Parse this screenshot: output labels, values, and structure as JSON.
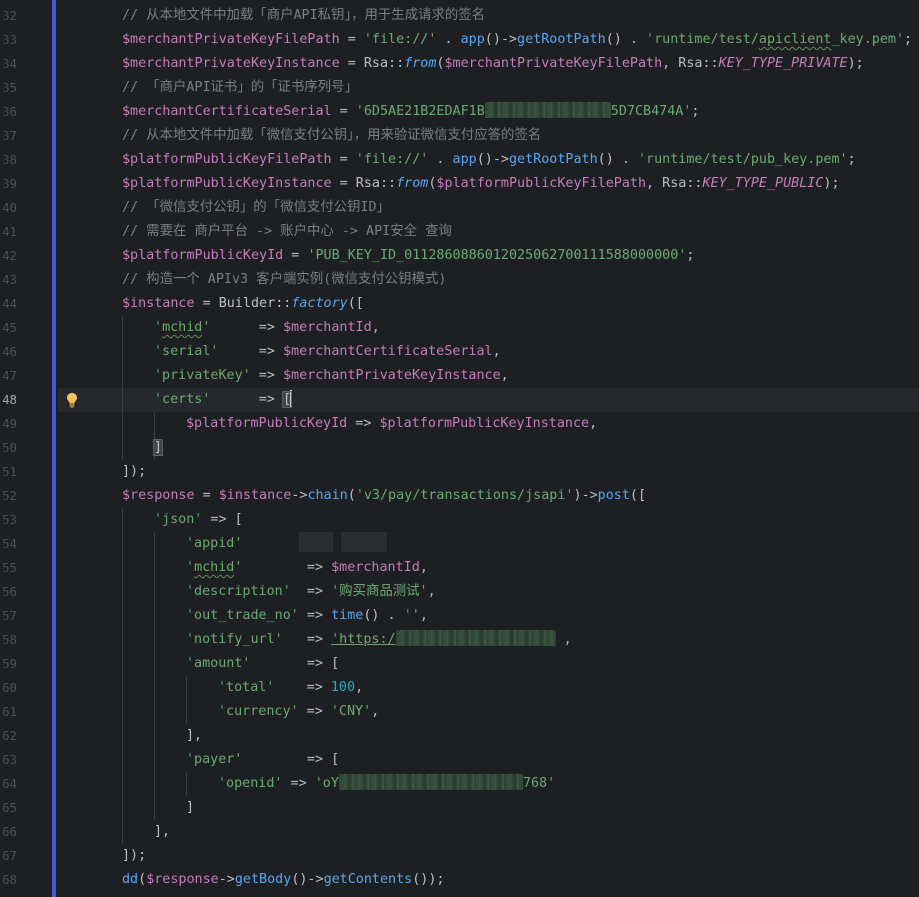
{
  "editor": {
    "line_numbers": [
      "32",
      "33",
      "34",
      "35",
      "36",
      "37",
      "38",
      "39",
      "40",
      "41",
      "42",
      "43",
      "44",
      "45",
      "46",
      "47",
      "48",
      "49",
      "50",
      "51",
      "52",
      "53",
      "54",
      "55",
      "56",
      "57",
      "58",
      "59",
      "60",
      "61",
      "62",
      "63",
      "64",
      "65",
      "66",
      "67",
      "68"
    ],
    "active_line": "48",
    "comments": {
      "l32": "// 从本地文件中加载「商户API私钥」，用于生成请求的签名",
      "l35": "// 「商户API证书」的「证书序列号」",
      "l37": "// 从本地文件中加载「微信支付公钥」，用来验证微信支付应答的签名",
      "l40": "// 「微信支付公钥」的「微信支付公钥ID」",
      "l41": "// 需要在 商户平台 -> 账户中心 -> API安全 查询",
      "l43": "// 构造一个 APIv3 客户端实例(微信支付公钥模式)"
    },
    "vars": {
      "merchantPrivateKeyFilePath": "$merchantPrivateKeyFilePath",
      "merchantPrivateKeyInstance": "$merchantPrivateKeyInstance",
      "merchantCertificateSerial": "$merchantCertificateSerial",
      "platformPublicKeyFilePath": "$platformPublicKeyFilePath",
      "platformPublicKeyInstance": "$platformPublicKeyInstance",
      "platformPublicKeyId": "$platformPublicKeyId",
      "instance": "$instance",
      "response": "$response",
      "merchantId": "$merchantId"
    },
    "strings": {
      "file_proto": "'file://'",
      "apiclient_path_a": "'runtime/test/",
      "apiclient_path_b": "apiclient",
      "apiclient_path_c": "_key.pem'",
      "serial_a": "'6D5AE21B2EDAF1B",
      "serial_b": "5D7CB474A'",
      "pub_key_path": "'runtime/test/pub_key.pem'",
      "pub_key_id": "'PUB_KEY_ID_0112860886012025062700111588000000'",
      "mchid": "'mchid'",
      "serial": "'serial'",
      "privateKey": "'privateKey'",
      "certs": "'certs'",
      "chain_path": "'v3/pay/transactions/jsapi'",
      "json": "'json'",
      "appid": "'appid'",
      "description": "'description'",
      "description_val": "'购买商品测试'",
      "out_trade_no": "'out_trade_no'",
      "empty": "''",
      "notify_url": "'notify_url'",
      "notify_val_a": "'https:/",
      "amount": "'amount'",
      "total": "'total'",
      "currency": "'currency'",
      "cny": "'CNY'",
      "payer": "'payer'",
      "openid": "'openid'",
      "openid_a": "'oY",
      "openid_b": "768'"
    },
    "idents": {
      "app": "app",
      "getRootPath": "getRootPath",
      "Rsa": "Rsa",
      "from": "from",
      "KEY_TYPE_PRIVATE": "KEY_TYPE_PRIVATE",
      "KEY_TYPE_PUBLIC": "KEY_TYPE_PUBLIC",
      "Builder": "Builder",
      "factory": "factory",
      "chain": "chain",
      "post": "post",
      "time": "time",
      "dd": "dd",
      "getBody": "getBody",
      "getContents": "getContents"
    },
    "numbers": {
      "total_val": "100"
    }
  }
}
